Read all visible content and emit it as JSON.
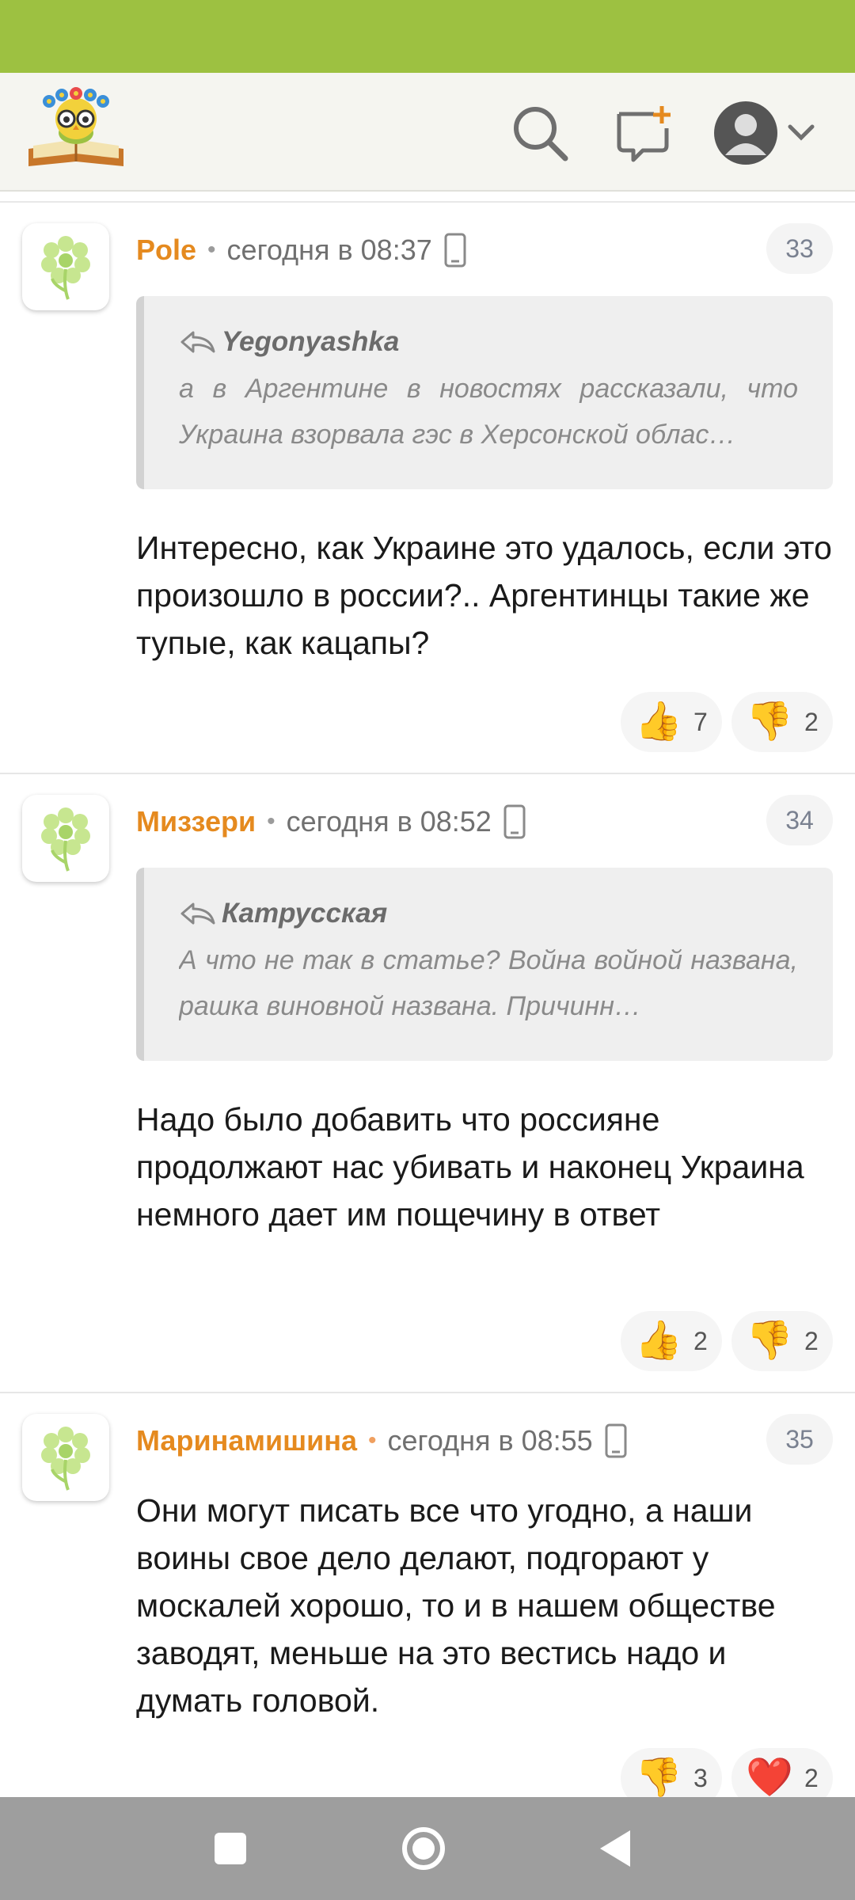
{
  "header": {
    "logo_icon": "book-owl-logo",
    "search_icon": "search-icon",
    "new_message_icon": "add-message-icon",
    "profile_icon": "user-avatar-icon",
    "menu_icon": "chevron-down-icon"
  },
  "comments": [
    {
      "author": "Pole",
      "time": "сегодня в 08:37",
      "number": "33",
      "quote": {
        "author": "Yegonyashka",
        "text": "а в Аргентине в новостях рассказали, что Украина взорвала гэс в Херсонской облас…"
      },
      "body": "Интересно, как Украине это удалось, если это произошло в россии?.. Аргентинцы такие же тупые, как кацапы?",
      "reactions": [
        {
          "emoji": "👍",
          "count": "7"
        },
        {
          "emoji": "👎",
          "count": "2"
        }
      ]
    },
    {
      "author": "Миззери",
      "time": "сегодня в 08:52",
      "number": "34",
      "quote": {
        "author": "Катрусская",
        "text": "А что не так в статье? Война войной названа, рашка виновной названа. Причинн…"
      },
      "body": "Надо было добавить что россияне продолжают нас убивать и наконец Украина немного дает им пощечину в ответ",
      "reactions": [
        {
          "emoji": "👍",
          "count": "2"
        },
        {
          "emoji": "👎",
          "count": "2"
        }
      ]
    },
    {
      "author": "Маринамишина",
      "time": "сегодня в 08:55",
      "number": "35",
      "body": "Они могут писать все что угодно, а наши воины свое дело делают, подгорают у москалей хорошо, то и в нашем обществе заводят, меньше на это вестись надо и думать головой.",
      "reactions": [
        {
          "emoji": "👎",
          "count": "3"
        },
        {
          "emoji": "❤️",
          "count": "2"
        }
      ]
    }
  ],
  "navigation": {
    "recent_icon": "square-recents-icon",
    "home_icon": "circle-home-icon",
    "back_icon": "triangle-back-icon"
  },
  "colors": {
    "status_bar": "#9dc141",
    "author": "#e58a1f",
    "nav_bar": "#9e9e9e"
  }
}
